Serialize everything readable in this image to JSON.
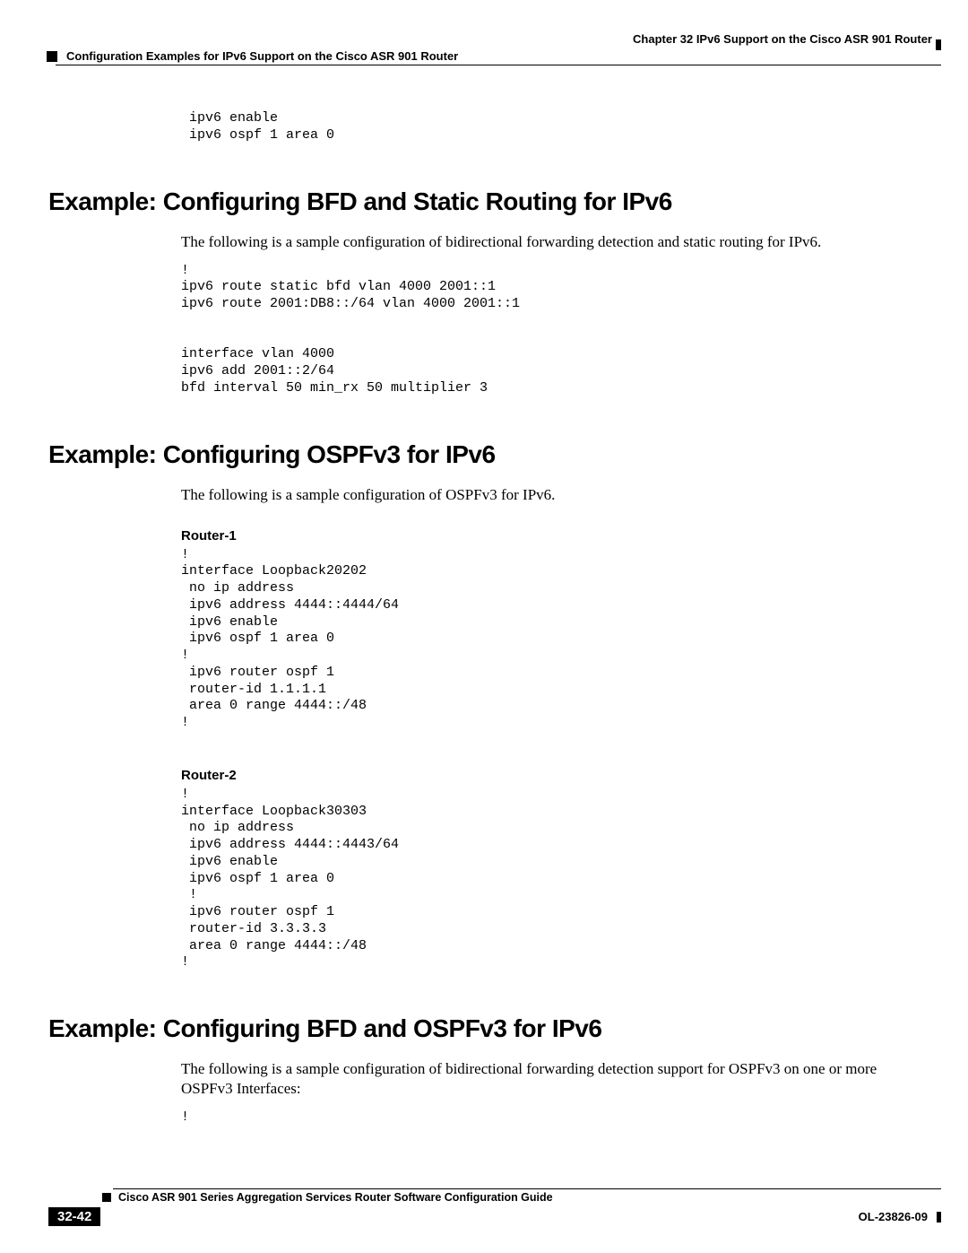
{
  "header": {
    "chapter": "Chapter 32      IPv6 Support on the Cisco ASR 901 Router",
    "section_label": "Configuration Examples for IPv6 Support on the Cisco ASR 901 Router"
  },
  "snippet_top": " ipv6 enable\n ipv6 ospf 1 area 0",
  "sections": {
    "bfd_static": {
      "title": "Example: Configuring BFD and Static Routing for IPv6",
      "intro": "The following is a sample configuration of bidirectional forwarding detection and static routing for IPv6.",
      "code": "!\nipv6 route static bfd vlan 4000 2001::1\nipv6 route 2001:DB8::/64 vlan 4000 2001::1\n\n\ninterface vlan 4000\nipv6 add 2001::2/64\nbfd interval 50 min_rx 50 multiplier 3"
    },
    "ospfv3": {
      "title": "Example: Configuring OSPFv3 for IPv6",
      "intro": "The following is a sample configuration of OSPFv3 for IPv6.",
      "router1_label": "Router-1",
      "router1_code": "!\ninterface Loopback20202\n no ip address\n ipv6 address 4444::4444/64\n ipv6 enable\n ipv6 ospf 1 area 0\n!\n ipv6 router ospf 1\n router-id 1.1.1.1\n area 0 range 4444::/48\n!",
      "router2_label": "Router-2",
      "router2_code": "!\ninterface Loopback30303\n no ip address\n ipv6 address 4444::4443/64\n ipv6 enable\n ipv6 ospf 1 area 0\n !\n ipv6 router ospf 1\n router-id 3.3.3.3\n area 0 range 4444::/48\n!"
    },
    "bfd_ospfv3": {
      "title": "Example: Configuring BFD and OSPFv3 for IPv6",
      "intro": "The following is a sample configuration of bidirectional forwarding detection support for OSPFv3 on one or more OSPFv3 Interfaces:",
      "code": "!"
    }
  },
  "footer": {
    "guide_title": "Cisco ASR 901 Series Aggregation Services Router Software Configuration Guide",
    "page_number": "32-42",
    "doc_id": "OL-23826-09"
  }
}
